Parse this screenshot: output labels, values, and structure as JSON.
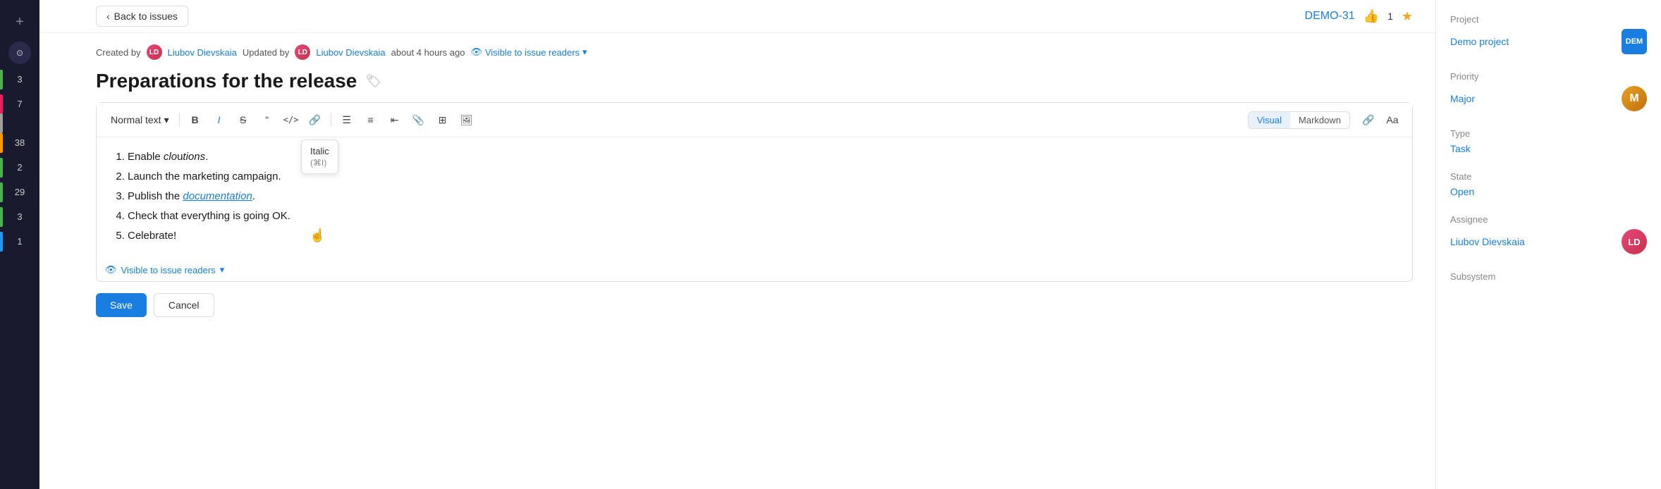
{
  "topbar": {
    "back_label": "Back to issues",
    "demo_id": "DEMO-31",
    "star_count": "1"
  },
  "meta": {
    "created_label": "Created by",
    "creator_name": "Liubov Dievskaia",
    "updated_label": "Updated by",
    "updater_name": "Liubov Dievskaia",
    "updated_time": "about 4 hours ago",
    "visible_label": "Visible to issue readers",
    "creator_initials": "LD",
    "updater_initials": "LD"
  },
  "title": "Preparations for the release",
  "toolbar": {
    "text_style": "Normal text",
    "bold": "B",
    "italic": "I",
    "strikethrough": "S",
    "quote": "“",
    "code": "</>",
    "link": "🔗",
    "bullet_list": "•≡",
    "ordered_list": "1≡",
    "indent_left": "⇤",
    "attachment": "📎",
    "table": "⊞",
    "image": "🖼",
    "visual_label": "Visual",
    "markdown_label": "Markdown",
    "link2": "🔗",
    "font": "Aa"
  },
  "tooltip": {
    "title": "Italic",
    "shortcut": "(⌘I)"
  },
  "editor": {
    "items": [
      {
        "id": 1,
        "pre": "Enable ",
        "italic": "clo",
        "mid": "u",
        "post": "tions."
      },
      {
        "id": 2,
        "text": "Launch the marketing campaign."
      },
      {
        "id": 3,
        "pre": "Publish the ",
        "link": "documentation",
        "post": "."
      },
      {
        "id": 4,
        "text": "Check that everything is going OK."
      },
      {
        "id": 5,
        "text": "Celebrate!"
      }
    ]
  },
  "editor_footer": {
    "visible_label": "Visible to issue readers"
  },
  "actions": {
    "save_label": "Save",
    "cancel_label": "Cancel"
  },
  "sidebar": {
    "project_label": "Project",
    "project_name": "Demo project",
    "project_badge": "DEM",
    "priority_label": "Priority",
    "priority_value": "Major",
    "priority_letter": "M",
    "type_label": "Type",
    "type_value": "Task",
    "state_label": "State",
    "state_value": "Open",
    "assignee_label": "Assignee",
    "assignee_name": "Liubov Dievskaia",
    "assignee_initials": "LD",
    "subsystem_label": "Subsystem"
  },
  "nav": {
    "items": [
      {
        "num": "3",
        "color": "#4caf50"
      },
      {
        "num": "7",
        "color": "#e91e63"
      },
      {
        "num": "",
        "color": "#9e9e9e"
      },
      {
        "num": "38",
        "color": "#ff9800"
      },
      {
        "num": "2",
        "color": "#4caf50"
      },
      {
        "num": "29",
        "color": "#4caf50"
      },
      {
        "num": "3",
        "color": "#4caf50"
      },
      {
        "num": "1",
        "color": "#2196f3"
      }
    ]
  }
}
